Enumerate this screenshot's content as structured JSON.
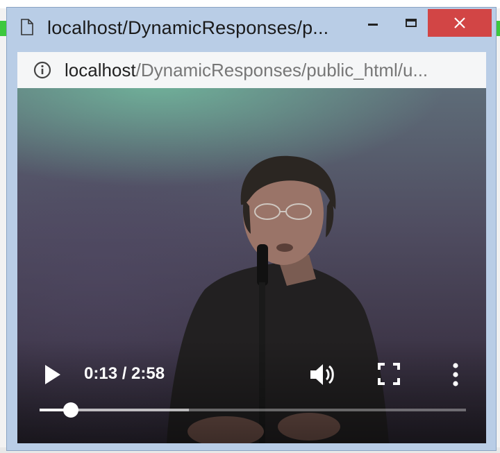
{
  "window": {
    "title": "localhost/DynamicResponses/p...",
    "close_label": "✕"
  },
  "address": {
    "host": "localhost",
    "path": "/DynamicResponses/public_html/u..."
  },
  "player": {
    "time_display": "0:13 / 2:58",
    "progress_fraction": 0.073,
    "buffered_fraction": 0.35
  },
  "icons": {
    "page": "document-icon",
    "info": "info-icon",
    "play": "play-icon",
    "volume": "volume-icon",
    "fullscreen": "fullscreen-icon",
    "menu": "more-vert-icon"
  },
  "colors": {
    "window_frame": "#b9cde6",
    "close_button": "#d24545"
  }
}
